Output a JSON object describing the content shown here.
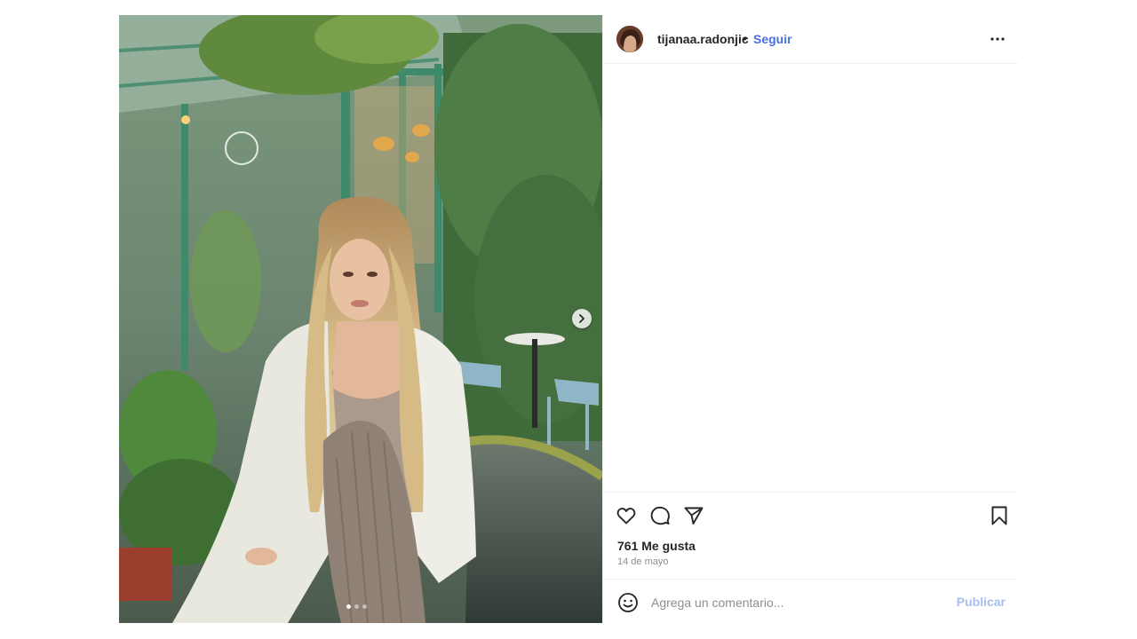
{
  "post": {
    "author": {
      "username": "tijanaa.radonjic",
      "separator": "•",
      "follow_label": "Seguir"
    },
    "media": {
      "slide_count": 3,
      "active_slide": 1
    },
    "likes_text": "761 Me gusta",
    "date_text": "14 de mayo",
    "comment": {
      "placeholder": "Agrega un comentario...",
      "publish_label": "Publicar"
    }
  },
  "icons": {
    "more": "more-options-icon",
    "like": "heart-icon",
    "comment": "comment-bubble-icon",
    "share": "send-icon",
    "save": "bookmark-icon",
    "emoji": "emoji-icon",
    "next": "chevron-right-icon"
  },
  "colors": {
    "follow": "#4a6ee0",
    "publish_disabled": "#a9bff0",
    "border": "#efefef"
  }
}
